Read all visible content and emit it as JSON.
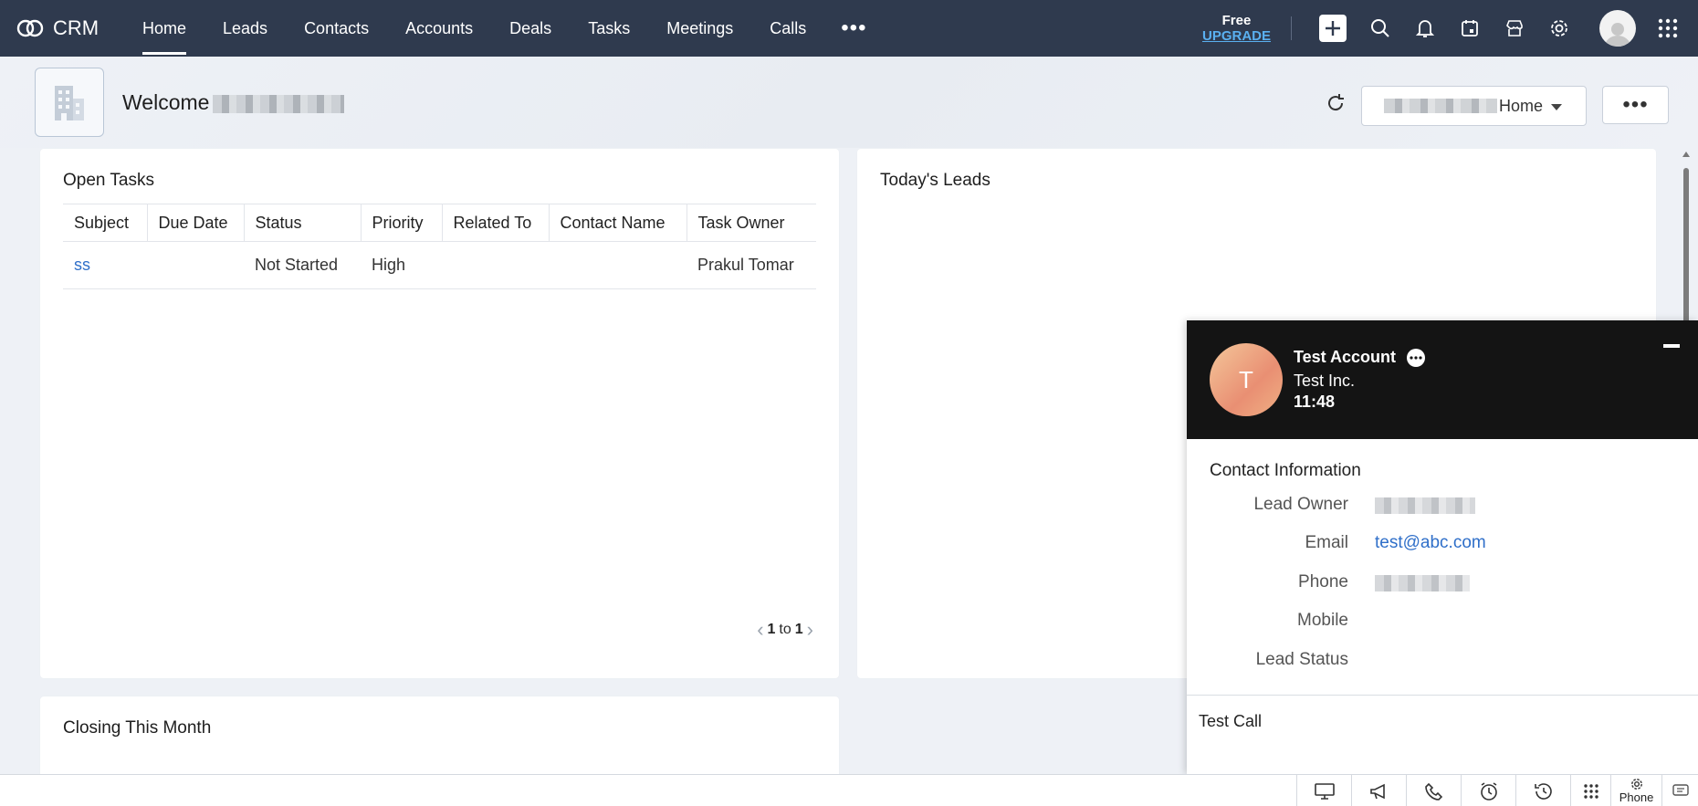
{
  "brand": {
    "name": "CRM"
  },
  "nav": {
    "tabs": [
      "Home",
      "Leads",
      "Contacts",
      "Accounts",
      "Deals",
      "Tasks",
      "Meetings",
      "Calls"
    ],
    "more": "•••"
  },
  "upgrade": {
    "free": "Free",
    "link": "UPGRADE"
  },
  "welcome": {
    "text": "Welcome"
  },
  "home_select": {
    "value": "Home"
  },
  "more_button": "•••",
  "open_tasks": {
    "title": "Open Tasks",
    "columns": [
      "Subject",
      "Due Date",
      "Status",
      "Priority",
      "Related To",
      "Contact Name",
      "Task Owner"
    ],
    "rows": [
      {
        "subject": "ss",
        "due_date": "",
        "status": "Not Started",
        "priority": "High",
        "related_to": "",
        "contact_name": "",
        "task_owner": "Prakul Tomar"
      }
    ],
    "pager": {
      "from": "1",
      "to_word": "to",
      "to": "1"
    }
  },
  "todays_leads": {
    "title": "Today's Leads"
  },
  "closing": {
    "title": "Closing This Month"
  },
  "call": {
    "avatar_letter": "T",
    "name": "Test Account",
    "company": "Test Inc.",
    "time": "11:48",
    "section_title": "Contact Information",
    "fields": [
      {
        "label": "Lead Owner",
        "value": ""
      },
      {
        "label": "Email",
        "value": "test@abc.com"
      },
      {
        "label": "Phone",
        "value": ""
      },
      {
        "label": "Mobile",
        "value": ""
      },
      {
        "label": "Lead Status",
        "value": ""
      }
    ],
    "note": "Test Call"
  },
  "bottom_bar": {
    "phone_label": "Phone"
  },
  "colors": {
    "nav_bg": "#2f3a4e",
    "link": "#2f6fc9",
    "upgrade": "#5ab0f0",
    "call_header": "#141414"
  }
}
